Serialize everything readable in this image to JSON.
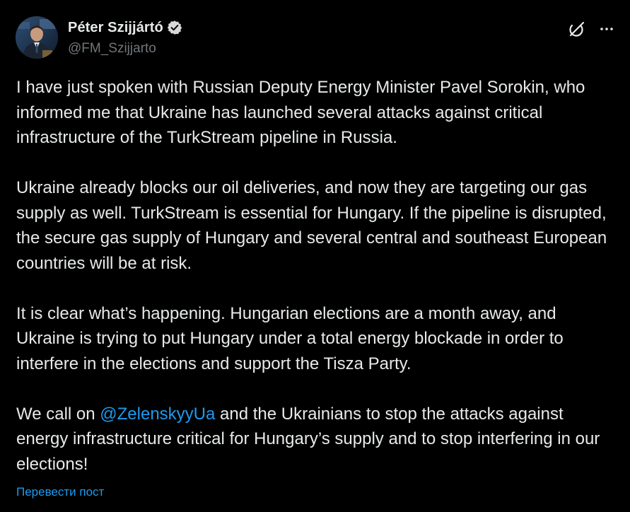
{
  "author": {
    "name": "Péter Szijjártó",
    "handle": "@FM_Szijjarto",
    "verified": true
  },
  "icons": {
    "avatar": "profile-photo",
    "verified": "verified-badge-icon",
    "grok": "grok-icon",
    "more": "more-options-icon"
  },
  "post": {
    "paragraph_1": "I have just spoken with Russian Deputy Energy Minister Pavel Sorokin, who informed me that Ukraine has launched several attacks against critical infrastructure of the TurkStream pipeline in Russia.",
    "paragraph_2": "Ukraine already blocks our oil deliveries, and now they are targeting our gas supply as well. TurkStream is essential for Hungary. If the pipeline is disrupted, the secure gas supply of Hungary and several central and southeast European countries will be at risk.",
    "paragraph_3": "It is clear what’s happening. Hungarian elections are a month away, and Ukraine is trying to put Hungary under a total energy blockade in order to interfere in the elections and support the Tisza Party.",
    "paragraph_4_before": "We call on ",
    "paragraph_4_mention": "@ZelenskyyUa",
    "paragraph_4_after": " and the Ukrainians to stop the attacks against energy infrastructure critical for Hungary’s supply and to stop interfering in our elections!"
  },
  "translate_label": "Перевести пост",
  "colors": {
    "background": "#000000",
    "text": "#e7e9ea",
    "secondary": "#71767b",
    "link": "#1d9bf0",
    "verified": "#d9d9d9"
  }
}
